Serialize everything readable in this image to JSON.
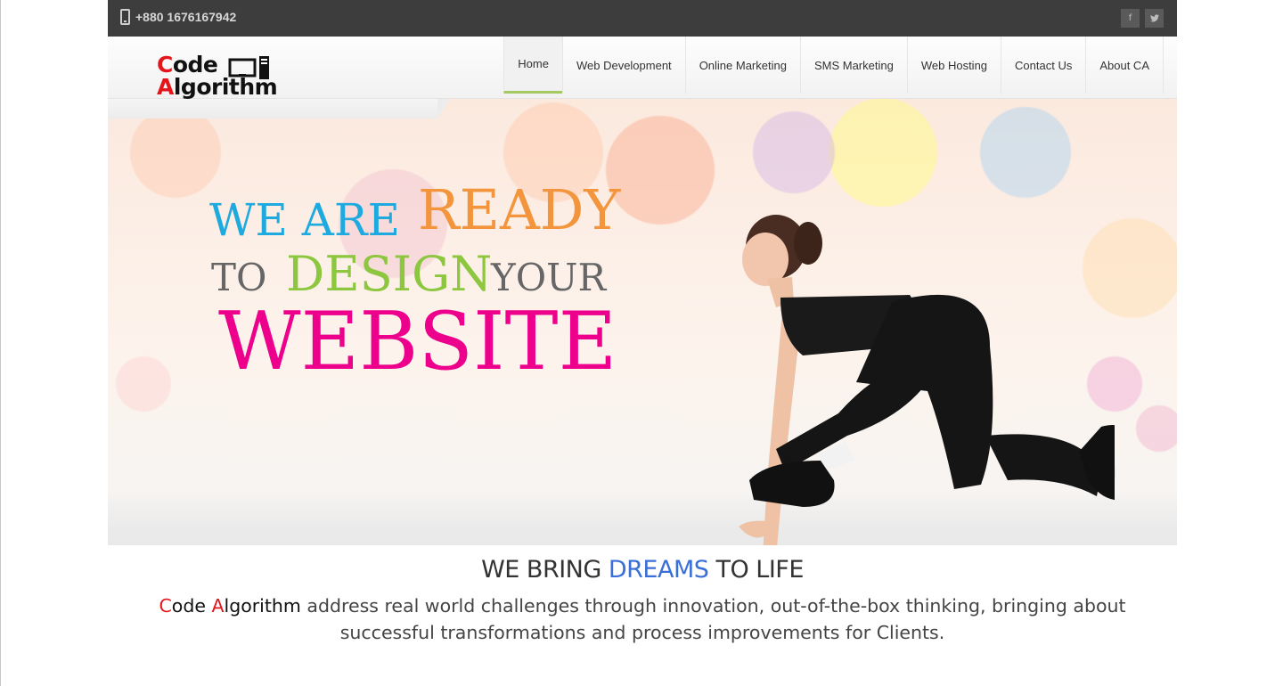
{
  "topbar": {
    "phone": "+880 1676167942",
    "social": [
      {
        "icon": "facebook-icon",
        "glyph": "f"
      },
      {
        "icon": "twitter-icon",
        "glyph": "t"
      }
    ]
  },
  "brand": {
    "line1_first": "C",
    "line1_rest": "ode",
    "line2_first": "A",
    "line2_rest": "lgorithm",
    "accent_color": "#e3161c"
  },
  "nav": {
    "items": [
      {
        "label": "Home",
        "active": true
      },
      {
        "label": "Web Development"
      },
      {
        "label": "Online Marketing"
      },
      {
        "label": "SMS Marketing"
      },
      {
        "label": "Web Hosting"
      },
      {
        "label": "Contact Us"
      },
      {
        "label": "About CA"
      }
    ],
    "active_color": "#a4c961"
  },
  "hero": {
    "line1_a": "WE ARE",
    "line1_b": "READY",
    "line2_a": "TO",
    "line2_b": "DESIGN",
    "line2_c": "YOUR",
    "line3": "WEBSITE",
    "colors": {
      "we_are": "#1faadf",
      "ready": "#f2953d",
      "design": "#8dc63f",
      "website": "#ec008c"
    }
  },
  "intro": {
    "title_a": "WE BRING ",
    "title_b": "DREAMS",
    "title_c": " TO LIFE",
    "brand_c": "C",
    "brand_ode": "ode ",
    "brand_a": "A",
    "brand_lgorithm": "lgorithm",
    "text": " address real world challenges through innovation, out-of-the-box thinking, bringing about successful transformations and process improvements for Clients."
  }
}
